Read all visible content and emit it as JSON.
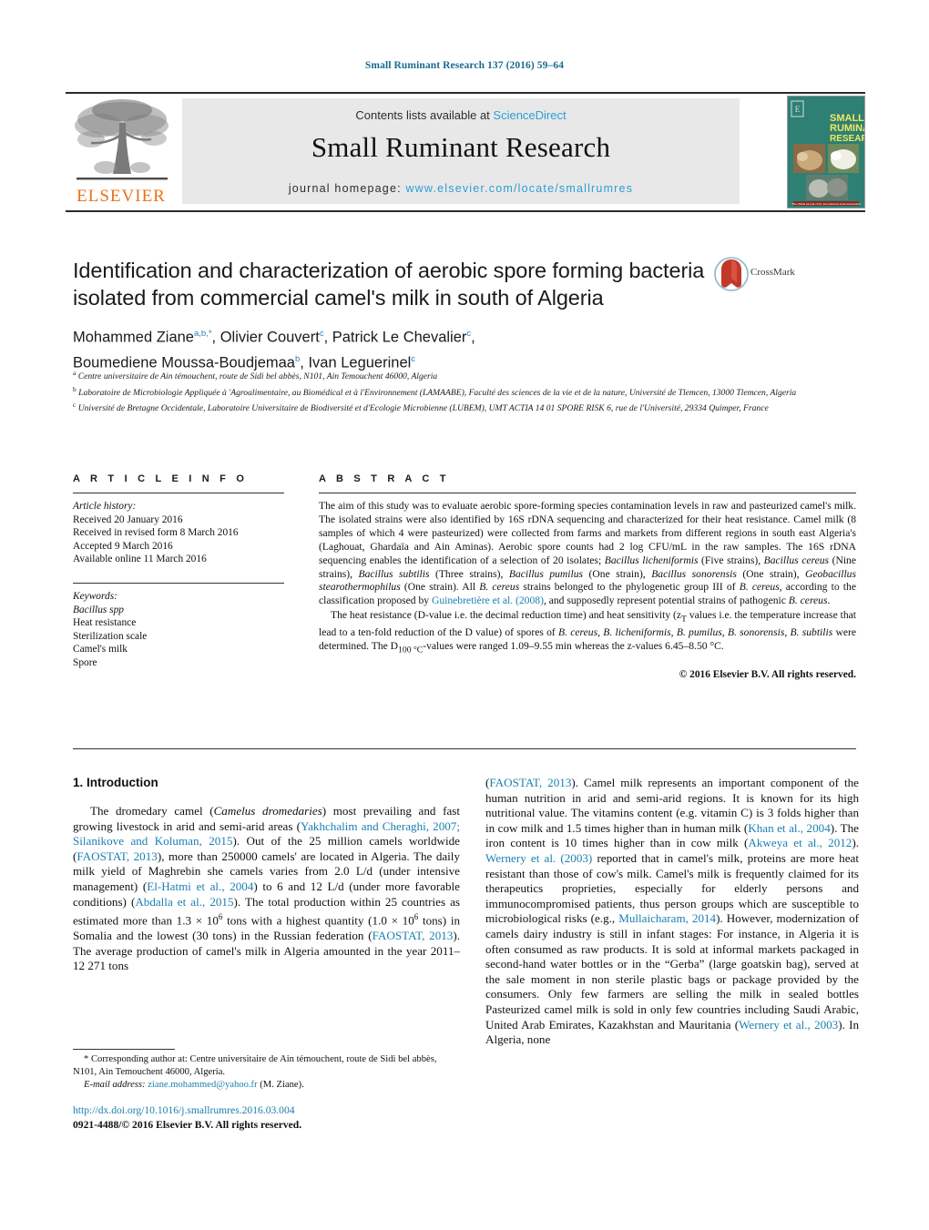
{
  "running_head": "Small Ruminant Research 137 (2016) 59–64",
  "masthead": {
    "contents_prefix": "Contents lists available at ",
    "sciencedirect": "ScienceDirect",
    "journal_title": "Small Ruminant Research",
    "homepage_prefix": "journal homepage: ",
    "homepage_url": "www.elsevier.com/locate/smallrumres",
    "publisher": "ELSEVIER",
    "cover_title_line1": "SMALL",
    "cover_title_line2": "RUMINANT",
    "cover_title_line3": "RESEARCH",
    "cover_footer": "The official journal of the International Goat Association",
    "colors": {
      "link": "#2b9fd4",
      "elsevier_orange": "#E9711C",
      "cover_teal": "#2e7f74",
      "running_head": "#1a6b8f"
    }
  },
  "article": {
    "title": "Identification and characterization of aerobic spore forming bacteria isolated from commercial camel's milk in south of Algeria",
    "crossmark_label": "CrossMark",
    "authors_line1_parts": [
      {
        "name": "Mohammed Ziane",
        "sup": "a,b,*"
      },
      {
        "name": "Olivier Couvert",
        "sup": "c"
      },
      {
        "name": "Patrick Le Chevalier",
        "sup": "c"
      }
    ],
    "authors_line2_parts": [
      {
        "name": "Boumediene Moussa-Boudjemaa",
        "sup": "b"
      },
      {
        "name": "Ivan Leguerinel",
        "sup": "c"
      }
    ],
    "affiliations": [
      {
        "marker": "a",
        "text": "Centre universitaire de Ain témouchent, route de Sidi bel abbès, N101, Ain Temouchent 46000, Algeria"
      },
      {
        "marker": "b",
        "text": "Laboratoire de Microbiologie Appliquée à 'Agroalimentaire, au Biomédical et à l'Environnement (LAMAABE), Faculté des sciences de la vie et de la nature, Université de Tlemcen, 13000 Tlemcen, Algeria"
      },
      {
        "marker": "c",
        "text": "Université de Bretagne Occidentale, Laboratoire Universitaire de Biodiversité et d'Ecologie Microbienne (LUBEM), UMT ACTIA 14 01 SPORE RISK 6, rue de l'Université, 29334 Quimper, France"
      }
    ]
  },
  "article_info": {
    "heading": "A R T I C L E   I N F O",
    "history_label": "Article history:",
    "history": [
      "Received 20 January 2016",
      "Received in revised form 8 March 2016",
      "Accepted 9 March 2016",
      "Available online 11 March 2016"
    ],
    "keywords_label": "Keywords:",
    "keywords": [
      "Bacillus spp",
      "Heat resistance",
      "Sterilization scale",
      "Camel's milk",
      "Spore"
    ]
  },
  "abstract": {
    "heading": "A B S T R A C T",
    "paragraph1": "The aim of this study was to evaluate aerobic spore-forming species contamination levels in raw and pasteurized camel's milk. The isolated strains were also identified by 16S rDNA sequencing and characterized for their heat resistance. Camel milk (8 samples of which 4 were pasteurized) were collected from farms and markets from different regions in south east Algeria's (Laghouat, Ghardaïa and Ain Aminas). Aerobic spore counts had 2 log CFU/mL in the raw samples. The 16S rDNA sequencing enables the identification of a selection of 20 isolates; Bacillus licheniformis (Five strains), Bacillus cereus (Nine strains), Bacillus subtilis (Three strains), Bacillus pumilus (One strain), Bacillus sonorensis (One strain), Geobacillus stearothermophilus (One strain). All B. cereus strains belonged to the phylogenetic group III of B. cereus, according to the classification proposed by Guinebretière et al. (2008), and supposedly represent potential strains of pathogenic B. cereus.",
    "paragraph1_reference": "Guinebretière et al. (2008)",
    "paragraph2": "The heat resistance (D-value i.e. the decimal reduction time) and heat sensitivity (zT values i.e. the temperature increase that lead to a ten-fold reduction of the D value) of spores of B. cereus, B. licheniformis, B. pumilus, B. sonorensis, B. subtilis were determined. The D100 °C-values were ranged 1.09–9.55 min whereas the z-values 6.45–8.50 °C.",
    "copyright": "© 2016 Elsevier B.V. All rights reserved."
  },
  "introduction": {
    "number_title": "1.  Introduction",
    "left_column": "The dromedary camel (Camelus dromedaries) most prevailing and fast growing livestock in arid and semi-arid areas (Yakhchalim and Cheraghi, 2007; Silanikove and Koluman, 2015). Out of the 25 million camels worldwide (FAOSTAT, 2013), more than 250000 camels' are located in Algeria. The daily milk yield of Maghrebin she camels varies from 2.0 L/d (under intensive management) (El-Hatmi et al., 2004) to 6 and 12 L/d (under more favorable conditions) (Abdalla et al., 2015). The total production within 25 countries as estimated more than 1.3 × 10^6 tons with a highest quantity (1.0 × 10^6 tons) in Somalia and the lowest (30 tons) in the Russian federation (FAOSTAT, 2013). The average production of camel's milk in Algeria amounted in the year 2011–12 271 tons",
    "right_column": "(FAOSTAT, 2013). Camel milk represents an important component of the human nutrition in arid and semi-arid regions. It is known for its high nutritional value. The vitamins content (e.g. vitamin C) is 3 folds higher than in cow milk and 1.5 times higher than in human milk (Khan et al., 2004). The iron content is 10 times higher than in cow milk (Akweya et al., 2012). Wernery et al. (2003) reported that in camel's milk, proteins are more heat resistant than those of cow's milk. Camel's milk is frequently claimed for its therapeutics proprieties, especially for elderly persons and immunocompromised patients, thus person groups which are susceptible to microbiological risks (e.g., Mullaicharam, 2014). However, modernization of camels dairy industry is still in infant stages: For instance, in Algeria it is often consumed as raw products. It is sold at informal markets packaged in second-hand water bottles or in the \"Gerba\" (large goatskin bag), served at the sale moment in non sterile plastic bags or package provided by the consumers. Only few farmers are selling the milk in sealed bottles Pasteurized camel milk is sold in only few countries including Saudi Arabic, United Arab Emirates, Kazakhstan and Mauritania (Wernery et al., 2003). In Algeria, none",
    "references_left": [
      "Yakhchalim and Cheraghi, 2007; Silanikove and Koluman, 2015",
      "FAOSTAT, 2013",
      "El-Hatmi et al., 2004",
      "Abdalla et al., 2015",
      "FAOSTAT, 2013"
    ],
    "references_right": [
      "FAOSTAT, 2013",
      "Khan et al., 2004",
      "Akweya et al., 2012",
      "Wernery et al. (2003)",
      "Mullaicharam, 2014",
      "Wernery et al., 2003"
    ]
  },
  "footer": {
    "corresponding_marker": "*",
    "corresponding_text": "Corresponding author at: Centre universitaire de Ain témouchent, route de Sidi bel abbès, N101, Ain Temouchent 46000, Algeria.",
    "email_label": "E-mail address:",
    "email": "ziane.mohammed@yahoo.fr",
    "email_owner": "(M. Ziane).",
    "doi": "http://dx.doi.org/10.1016/j.smallrumres.2016.03.004",
    "issn_line": "0921-4488/© 2016 Elsevier B.V. All rights reserved."
  }
}
